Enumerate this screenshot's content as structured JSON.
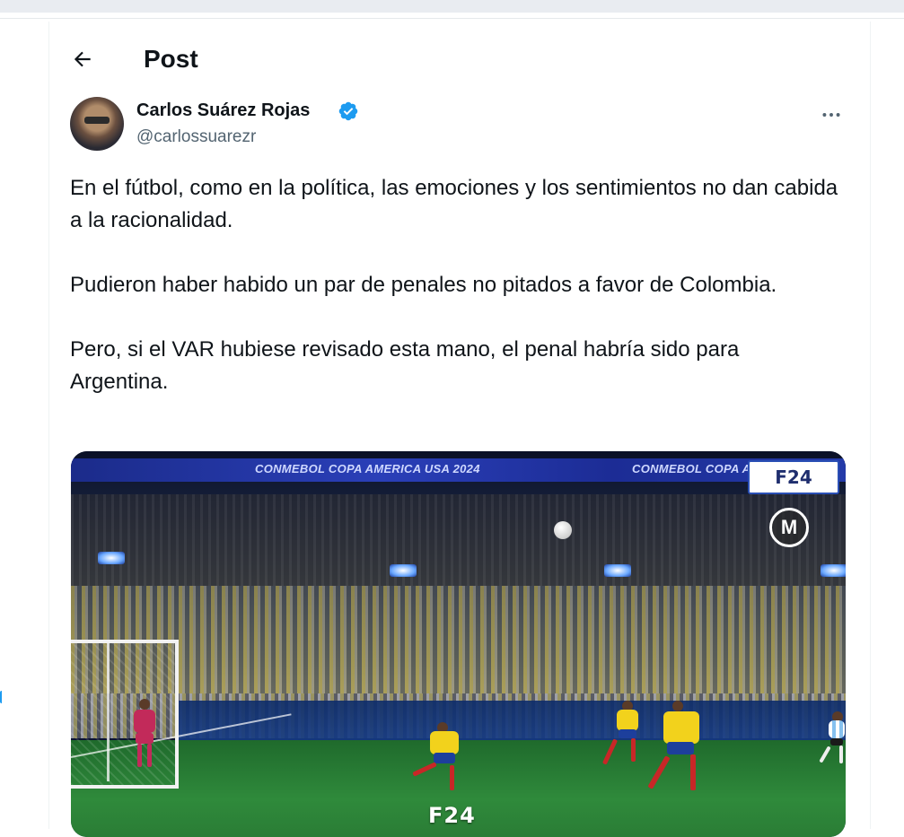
{
  "header": {
    "title": "Post",
    "back_icon": "arrow-left-icon"
  },
  "author": {
    "name": "Carlos Suárez Rojas",
    "handle": "@carlossuarezr",
    "verified_icon": "verified-badge-icon",
    "verified_color": "#1d9bf0",
    "more_icon": "more-horizontal-icon"
  },
  "tweet": {
    "paragraphs": [
      "En el fútbol, como en la política, las emociones y los sentimientos no dan cabida a la racionalidad.",
      "Pudieron haber habido un par de penales no pitados a favor de Colombia.",
      "Pero, si el VAR hubiese revisado esta mano, el penal habría sido para Argentina."
    ]
  },
  "media": {
    "ribbon_left": "CONMEBOL COPA AMERICA USA 2024",
    "ribbon_right": "CONMEBOL COPA A",
    "watermark_top": "F24",
    "watermark_bottom": "F24",
    "logo_letter": "M"
  },
  "colors": {
    "text": "#0f1419",
    "secondary": "#536471",
    "accent": "#1d9bf0"
  }
}
